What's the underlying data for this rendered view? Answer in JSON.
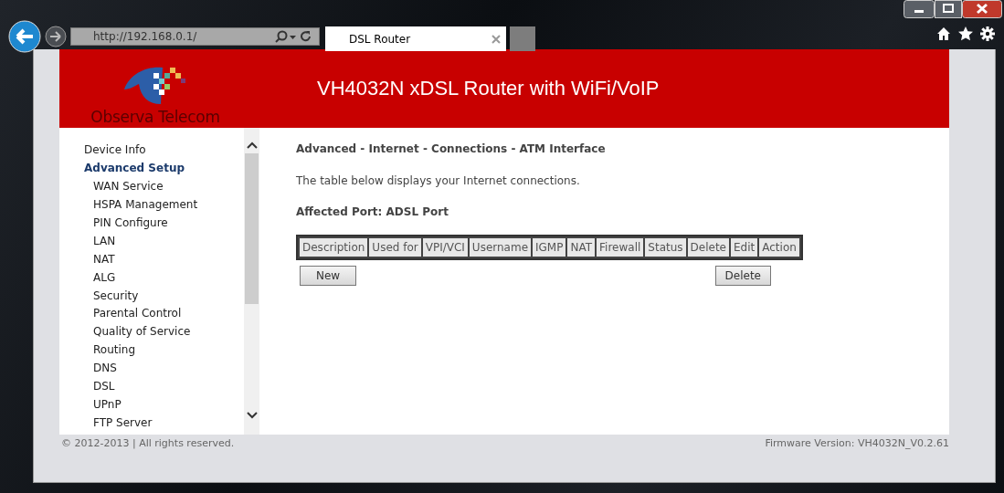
{
  "browser": {
    "address": "http://192.168.0.1/",
    "tab_title": "DSL Router"
  },
  "header": {
    "logo_text": "Observa Telecom",
    "title": "VH4032N xDSL Router with WiFi/VoIP"
  },
  "sidebar": {
    "items": [
      {
        "label": "Device Info",
        "selected": false
      },
      {
        "label": "Advanced Setup",
        "selected": true,
        "children": [
          {
            "label": "WAN Service",
            "selected": false
          },
          {
            "label": "HSPA Management",
            "selected": false
          },
          {
            "label": "PIN Configure",
            "selected": false
          },
          {
            "label": "LAN",
            "selected": false
          },
          {
            "label": "NAT",
            "selected": false
          },
          {
            "label": "ALG",
            "selected": false
          },
          {
            "label": "Security",
            "selected": false
          },
          {
            "label": "Parental Control",
            "selected": false
          },
          {
            "label": "Quality of Service",
            "selected": false
          },
          {
            "label": "Routing",
            "selected": false
          },
          {
            "label": "DNS",
            "selected": false
          },
          {
            "label": "DSL",
            "selected": false
          },
          {
            "label": "UPnP",
            "selected": false
          },
          {
            "label": "FTP Server",
            "selected": false
          }
        ]
      }
    ]
  },
  "main": {
    "heading": "Advanced - Internet - Connections - ATM Interface",
    "description": "The table below displays your Internet connections.",
    "affected_port": "Affected Port: ADSL Port",
    "table": {
      "columns": [
        "Description",
        "Used for",
        "VPI/VCI",
        "Username",
        "IGMP",
        "NAT",
        "Firewall",
        "Status",
        "Delete",
        "Edit",
        "Action"
      ]
    },
    "buttons": [
      "New",
      "Delete"
    ]
  },
  "footer": {
    "copyright": "© 2012-2013 | All rights reserved.",
    "firmware": "Firmware Version: VH4032N_V0.2.61"
  }
}
